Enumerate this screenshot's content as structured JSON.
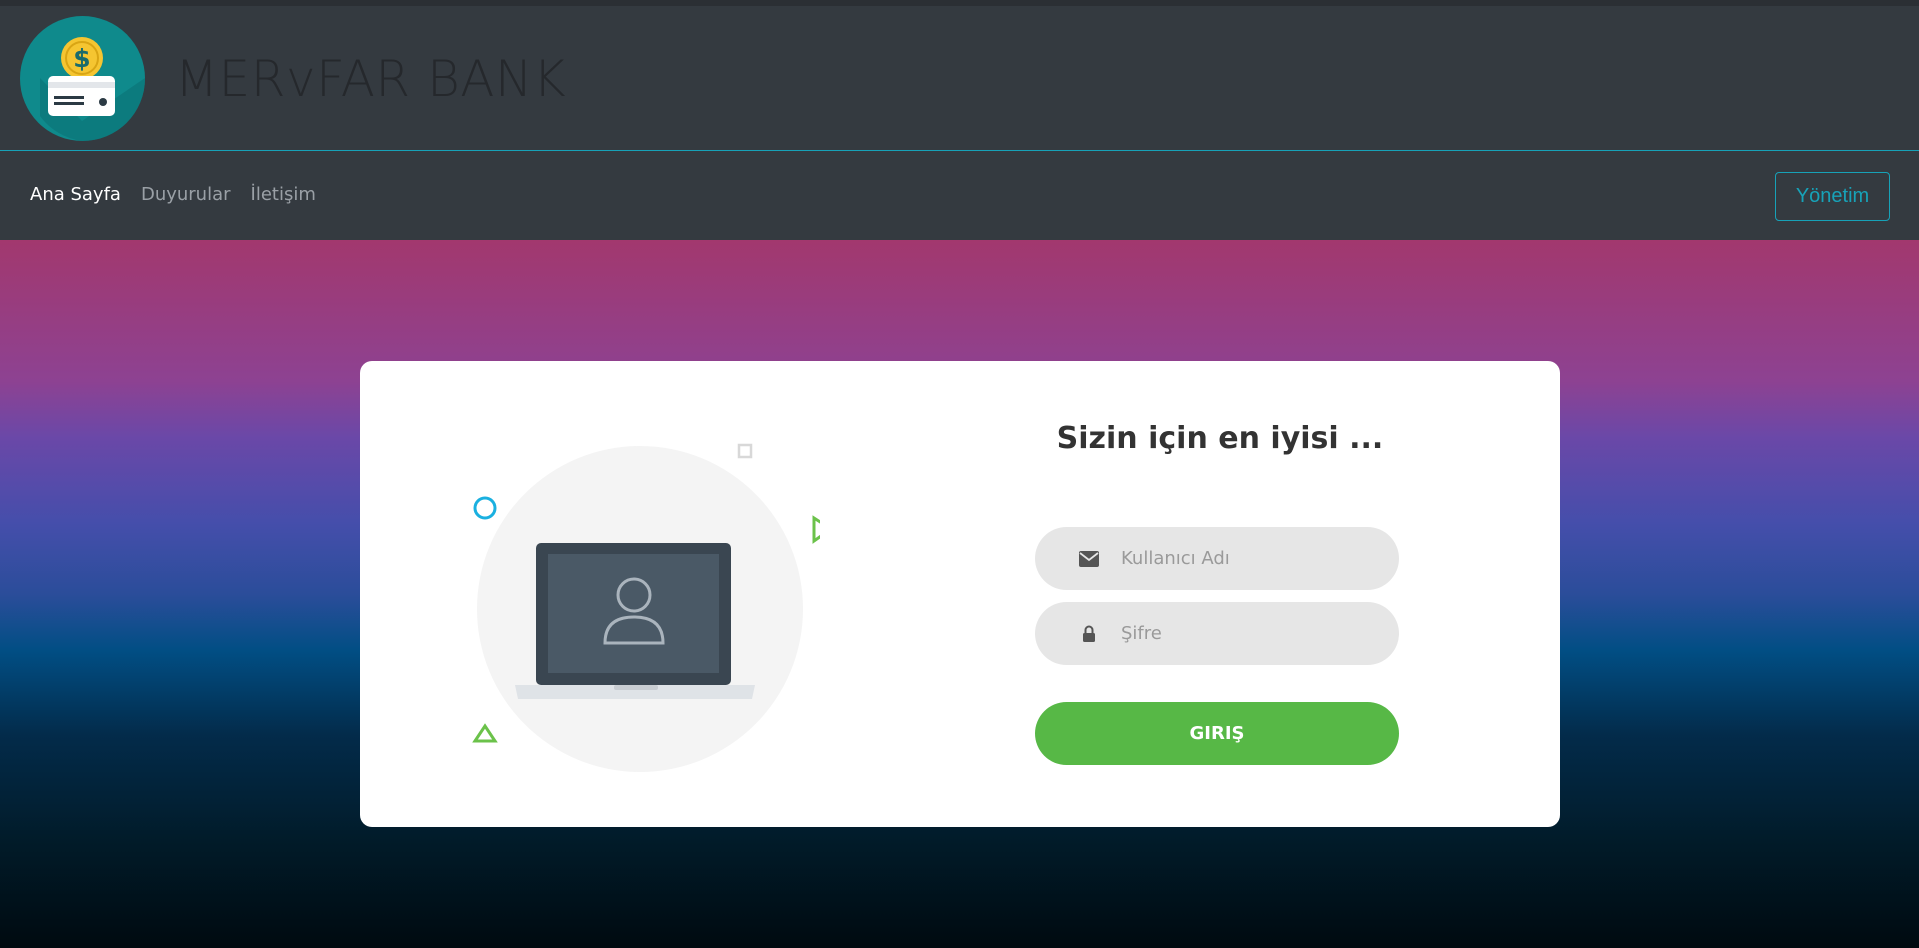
{
  "brand": {
    "name": "MERvFAR BANK",
    "logo": "bank-card-dollar-logo"
  },
  "nav": {
    "items": [
      {
        "label": "Ana Sayfa",
        "active": true
      },
      {
        "label": "Duyurular",
        "active": false
      },
      {
        "label": "İletişim",
        "active": false
      }
    ],
    "admin_label": "Yönetim"
  },
  "login": {
    "title": "Sizin için en iyisi ...",
    "username_placeholder": "Kullanıcı Adı",
    "password_placeholder": "Şifre",
    "submit_label": "GIRIŞ",
    "username_icon": "envelope-icon",
    "password_icon": "lock-icon"
  },
  "colors": {
    "accent": "#17a2b8",
    "submit": "#57b846",
    "header_bg": "#343a40"
  }
}
